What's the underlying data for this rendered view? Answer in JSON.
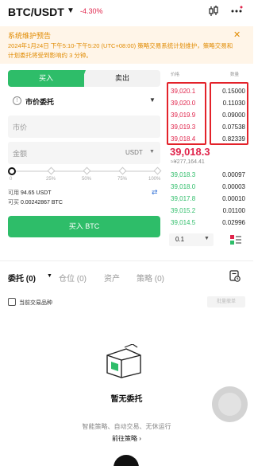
{
  "header": {
    "pair": "BTC/USDT",
    "change": "-4.30%",
    "chart_icon": "candlestick-icon",
    "more_icon": "more-dots-icon"
  },
  "notice": {
    "title": "系统维护预告",
    "body": "2024年1月24日 下午5:10-下午5:20 (UTC+08:00) 策略交易系统计划维护，策略交易和计划委托将受到影响约 3 分钟。",
    "close": "✕"
  },
  "trade": {
    "buy_tab": "买入",
    "sell_tab": "卖出",
    "order_type": "市价委托",
    "price_placeholder": "市价",
    "amount_placeholder": "金额",
    "amount_unit": "USDT",
    "slider_marks": [
      "0",
      "25%",
      "50%",
      "75%",
      "100%"
    ],
    "slider_value": 0,
    "available_label": "可用",
    "available_value": "94.65 USDT",
    "can_buy_label": "可买",
    "can_buy_value": "0.00242867 BTC",
    "buy_button": "买入 BTC"
  },
  "orderbook": {
    "price_header": "价格",
    "qty_header": "数量",
    "asks": [
      {
        "price": "39,020.1",
        "qty": "0.15000"
      },
      {
        "price": "39,020.0",
        "qty": "0.11030"
      },
      {
        "price": "39,019.9",
        "qty": "0.09000"
      },
      {
        "price": "39,019.3",
        "qty": "0.07538"
      },
      {
        "price": "39,018.4",
        "qty": "0.82339"
      }
    ],
    "last_price": "39,018.3",
    "last_fiat": "≈¥277,164.41",
    "bids": [
      {
        "price": "39,018.3",
        "qty": "0.00097"
      },
      {
        "price": "39,018.0",
        "qty": "0.00003"
      },
      {
        "price": "39,017.8",
        "qty": "0.00010"
      },
      {
        "price": "39,015.2",
        "qty": "0.01100"
      },
      {
        "price": "39,014.5",
        "qty": "0.02996"
      }
    ],
    "depth": "0.1"
  },
  "orders": {
    "tabs": [
      "委托 (0)",
      "仓位 (0)",
      "资产",
      "策略 (0)"
    ],
    "current_only": "当前交易品种",
    "batch_cancel": "批量撤单",
    "empty_title": "暂无委托",
    "empty_sub": "智能策略、自动交易、无休运行",
    "empty_link": "前往策略 ›"
  },
  "colors": {
    "buy_green": "#2ebd69",
    "sell_red": "#e0244b",
    "notice_orange": "#e08a00",
    "highlight_box": "#e3222a"
  }
}
